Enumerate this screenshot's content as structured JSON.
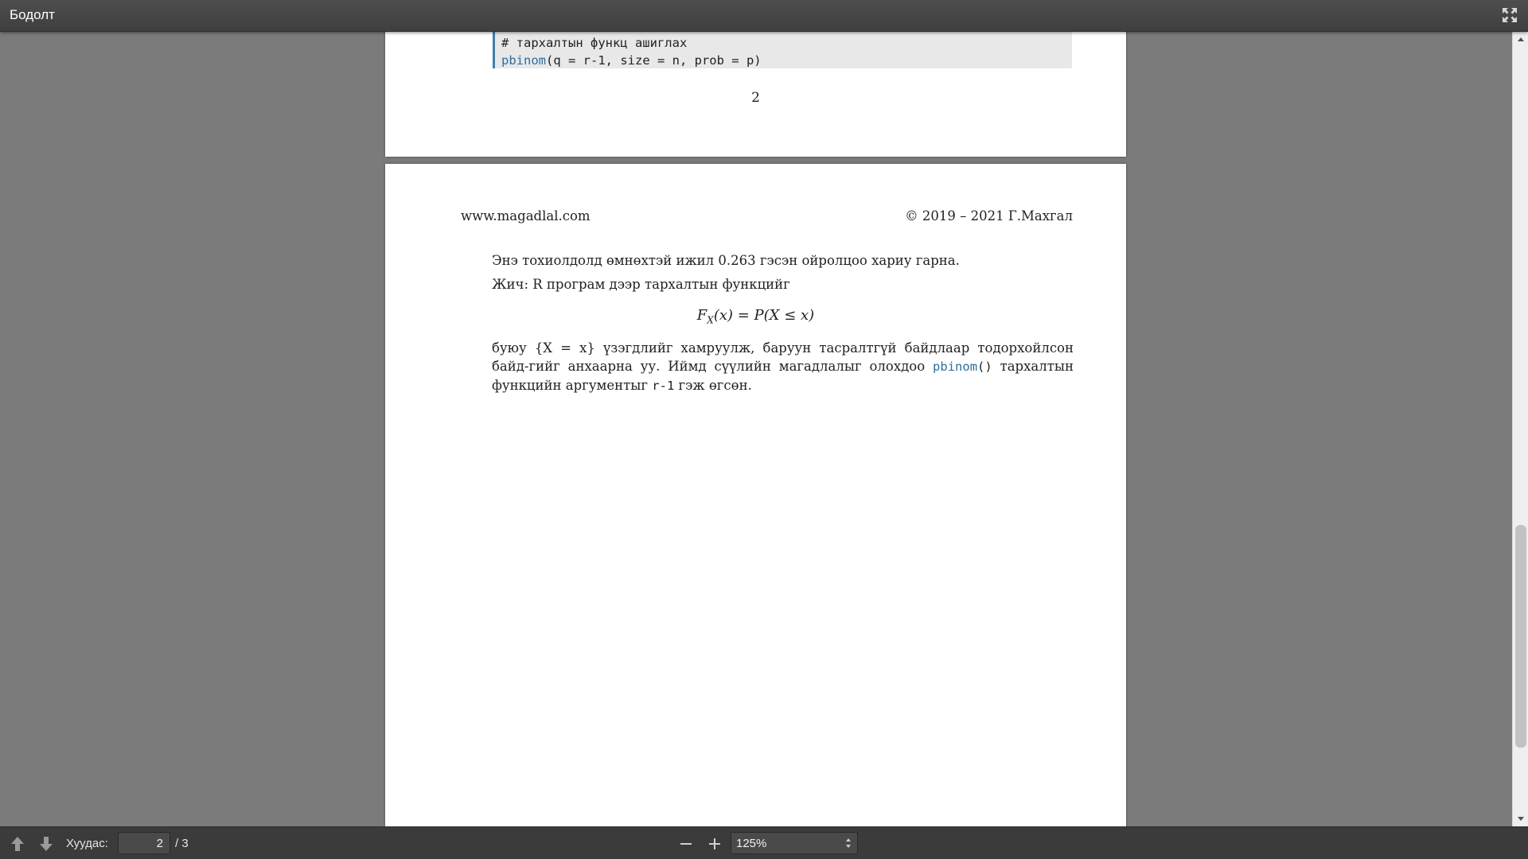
{
  "window": {
    "title": "Бодолт",
    "fullscreen_icon": "fullscreen-icon"
  },
  "previous_page": {
    "code_comment": "# тархалтын функц ашиглах",
    "code_func": "pbinom",
    "code_args": "(q = r-1, size = n, prob = p)",
    "page_number": "2"
  },
  "current_page": {
    "header_left": "www.magadlal.com",
    "header_right": "© 2019 – 2021 Г.Махгал",
    "paragraph1": "Энэ тохиолдолд өмнөхтэй ижил 0.263 гэсэн ойролцоо хариу гарна.",
    "paragraph2": "Жич: R програм дээр тархалтын функцийг",
    "formula_lhs": "F",
    "formula_sub": "X",
    "formula_rhs": "(x) = P(X ≤ x)",
    "p3_part1": "буюу {X = x} үзэгдлийг хамруулж, баруун тасралтгүй байдлаар тодорхойлсон байд-гийг анхаарна уу. Иймд сүүлийн магадлалыг олохдоо ",
    "p3_func": "pbinom",
    "p3_part2": "()",
    "p3_part3": " тархалтын функцийн аргументыг ",
    "p3_arg": "r-1",
    "p3_part4": " гэж өгсөн."
  },
  "toolbar": {
    "prev_icon": "arrow-up-icon",
    "next_icon": "arrow-down-icon",
    "page_label": "Хуудас:",
    "page_value": "2",
    "page_total": "/ 3",
    "zoom_value": "125%"
  },
  "colors": {
    "code_keyword": "#2a6fa1",
    "titlebar": "#474747",
    "toolbar": "#3b3b3b",
    "background": "#7b7b7b"
  }
}
